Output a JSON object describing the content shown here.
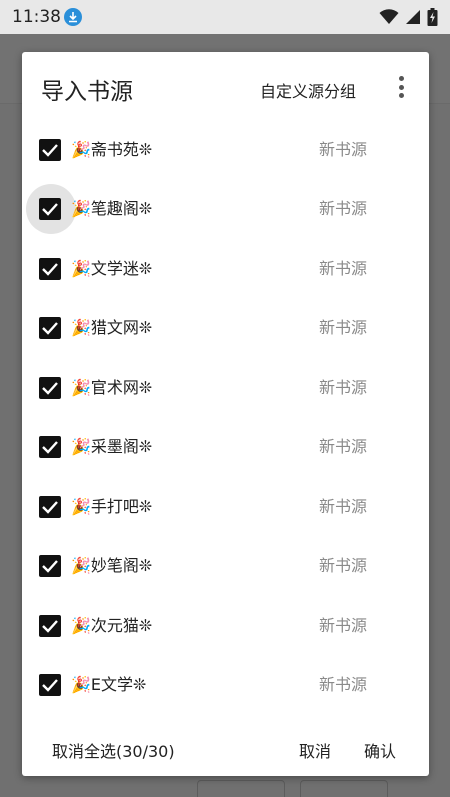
{
  "status_bar": {
    "time": "11:38",
    "icons": [
      "download-icon",
      "wifi-icon",
      "cell-signal-icon",
      "battery-charging-icon"
    ]
  },
  "dialog": {
    "title": "导入书源",
    "custom_group_label": "自定义源分组",
    "more_icon": "more-vert-icon",
    "items": [
      {
        "name": "🎉斋书苑❊",
        "group": "新书源",
        "checked": true
      },
      {
        "name": "🎉笔趣阁❊",
        "group": "新书源",
        "checked": true
      },
      {
        "name": "🎉文学迷❊",
        "group": "新书源",
        "checked": true
      },
      {
        "name": "🎉猎文网❊",
        "group": "新书源",
        "checked": true
      },
      {
        "name": "🎉官术网❊",
        "group": "新书源",
        "checked": true
      },
      {
        "name": "🎉采墨阁❊",
        "group": "新书源",
        "checked": true
      },
      {
        "name": "🎉手打吧❊",
        "group": "新书源",
        "checked": true
      },
      {
        "name": "🎉妙笔阁❊",
        "group": "新书源",
        "checked": true
      },
      {
        "name": "🎉次元猫❊",
        "group": "新书源",
        "checked": true
      },
      {
        "name": "🎉E文学❊",
        "group": "新书源",
        "checked": true
      }
    ],
    "footer": {
      "deselect_all_label": "取消全选(30/30)",
      "cancel_label": "取消",
      "confirm_label": "确认"
    }
  },
  "colors": {
    "checkbox": "#111111",
    "download_badge": "#2a8fd9",
    "secondary_text": "#8a8a8a"
  }
}
